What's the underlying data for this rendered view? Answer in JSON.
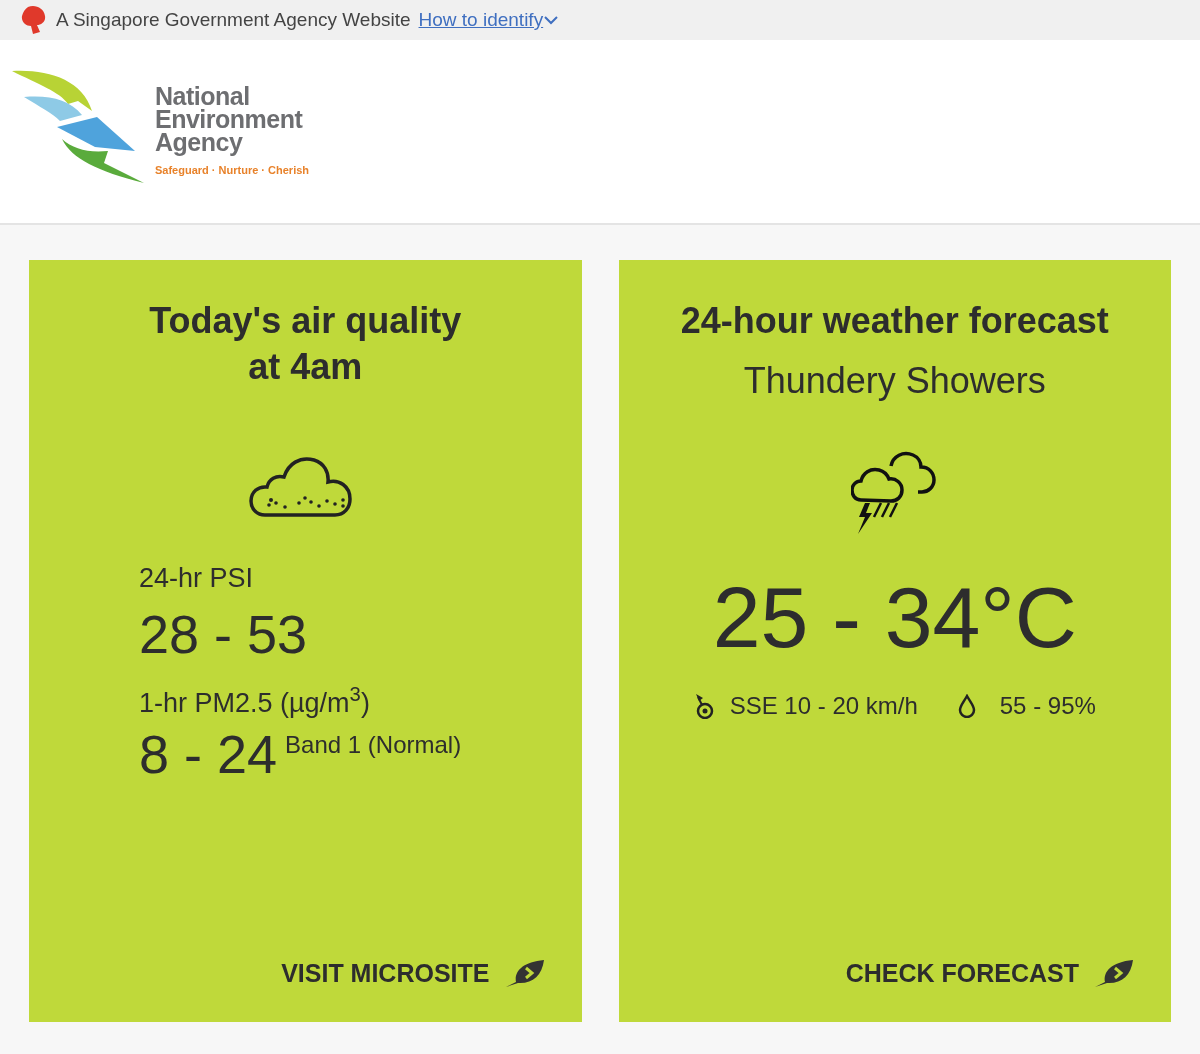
{
  "masthead": {
    "text": "A Singapore Government Agency Website",
    "link": "How to identify"
  },
  "logo": {
    "lines": [
      "National",
      "Environment",
      "Agency"
    ],
    "tagline": "Safeguard · Nurture · Cherish"
  },
  "air_card": {
    "title": "Today's air quality at 4am",
    "psi_label": "24-hr PSI",
    "psi_value": "28 - 53",
    "pm_label": "1-hr PM2.5 (µg/m$^{3}$)",
    "pm_value": "8 - 24",
    "pm_band": "Band 1 (Normal)",
    "action": "VISIT MICROSITE"
  },
  "weather_card": {
    "title": "24-hour weather forecast",
    "condition": "Thundery Showers",
    "temperature": "25 - 34°C",
    "wind": "SSE 10 - 20 km/h",
    "humidity": "55 - 95%",
    "action": "CHECK FORECAST"
  }
}
